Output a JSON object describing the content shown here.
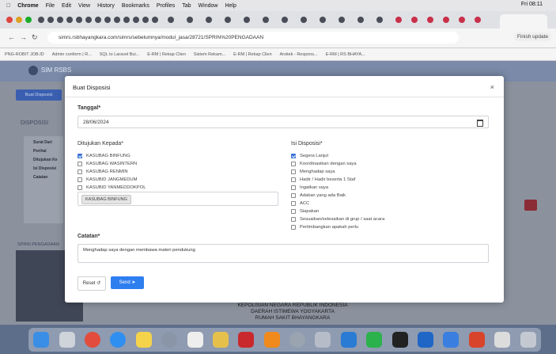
{
  "menubar": {
    "app": "Chrome",
    "items": [
      "File",
      "Edit",
      "View",
      "History",
      "Bookmarks",
      "Profiles",
      "Tab",
      "Window",
      "Help"
    ],
    "clock": "Fri 08:11"
  },
  "url": "simrs.rsbhayangkara.com/simrs/sebelumnya/modul_jasa/28721/SPRIN%20PENGADAAN",
  "profile": "Finish update",
  "bookmarks": [
    "PNG-ROBIT JOB.ID",
    "Admin conform | R...",
    "SQL to Laravel Bui...",
    "E-RM | Rekap Clien",
    "Sistem Rekam...",
    "E-RM | Rekap Clien",
    "Arsitek - Respons...",
    "E-RM | RS BHAYA..."
  ],
  "app": {
    "brand": "SIM RSBS",
    "left_button": "Buat Disposisi",
    "section_title": "DISPOSISI",
    "left_fields": [
      "Surat Dari",
      "Perihal",
      "Ditujukan Ke",
      "Isi Disposisi",
      "Catatan"
    ],
    "bottom_title": "SPRIN PENGADAAN"
  },
  "modal": {
    "title": "Buat Disposisi",
    "close": "×",
    "tanggal_label": "Tanggal*",
    "tanggal_value": "28/06/2024",
    "ditujukan_label": "Ditujukan Kepada*",
    "ditujukan": [
      {
        "label": "KASUBAG BINFUNG",
        "checked": true
      },
      {
        "label": "KASUBAG WASINTERN",
        "checked": false
      },
      {
        "label": "KASUBAG RENMIN",
        "checked": false
      },
      {
        "label": "KASUBID JANGMEDUM",
        "checked": false
      },
      {
        "label": "KASUBID YANMEDDOKPOL",
        "checked": false
      }
    ],
    "selected_tag": "KASUBAG BINFUNG",
    "isi_label": "Isi Disposisi*",
    "isi": [
      {
        "label": "Segera Lanjut",
        "checked": true
      },
      {
        "label": "Koordinasikan dengan saya",
        "checked": false
      },
      {
        "label": "Menghadap saya",
        "checked": false
      },
      {
        "label": "Hadir / Hadir beserta 1 Staf",
        "checked": false
      },
      {
        "label": "Ingatkan saya",
        "checked": false
      },
      {
        "label": "Adakan yang ada Baik",
        "checked": false
      },
      {
        "label": "ACC",
        "checked": false
      },
      {
        "label": "Siapakan",
        "checked": false
      },
      {
        "label": "Sesuaikan/selesaikan di grup / saat acara",
        "checked": false
      },
      {
        "label": "Pertimbangkan apakah perlu",
        "checked": false
      }
    ],
    "catatan_label": "Catatan*",
    "catatan_value": "Menghadap saya dengan membawa materi pendukung",
    "reset_label": "Reset",
    "send_label": "Send"
  },
  "doc_text": [
    "KEPOLISIAN NEGARA REPUBLIK INDONESIA",
    "DAERAH ISTIMEWA YOGYAKARTA",
    "RUMAH SAKIT BHAYANGKARA"
  ]
}
